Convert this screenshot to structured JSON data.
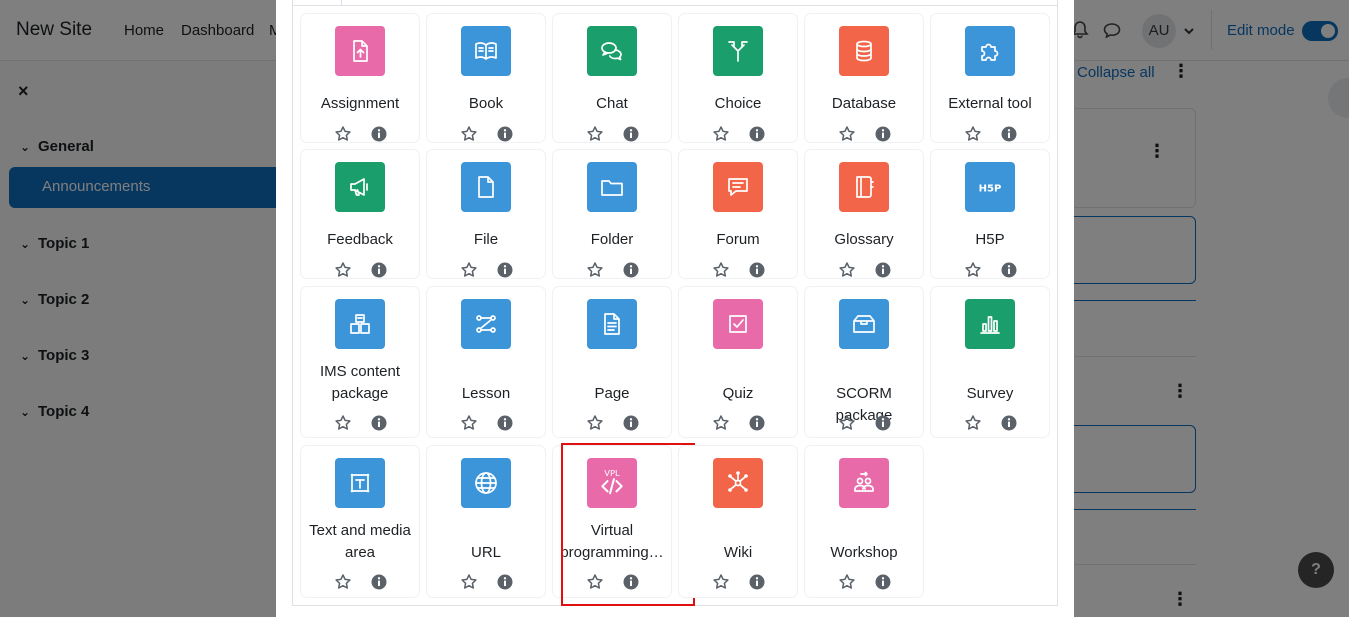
{
  "navbar": {
    "site_name": "New Site",
    "links": [
      "Home",
      "Dashboard",
      "M"
    ],
    "avatar_initials": "AU",
    "edit_mode_label": "Edit mode"
  },
  "drawer": {
    "close_label": "×",
    "sections": [
      {
        "label": "General",
        "expanded": true
      },
      {
        "label": "Topic 1"
      },
      {
        "label": "Topic 2"
      },
      {
        "label": "Topic 3"
      },
      {
        "label": "Topic 4"
      }
    ],
    "active_item": "Announcements"
  },
  "main": {
    "collapse_all": "Collapse all",
    "help_label": "?"
  },
  "colors": {
    "pink": "#e96aa9",
    "blue": "#3d95d9",
    "green": "#1a9e6b",
    "red": "#f26549",
    "brand": "#0f6cbf",
    "highlight": "#e01010"
  },
  "activities": [
    {
      "label": "Assignment",
      "icon": "assignment-icon",
      "color": "pink"
    },
    {
      "label": "Book",
      "icon": "book-icon",
      "color": "blue"
    },
    {
      "label": "Chat",
      "icon": "chat-icon",
      "color": "green"
    },
    {
      "label": "Choice",
      "icon": "choice-icon",
      "color": "green"
    },
    {
      "label": "Database",
      "icon": "database-icon",
      "color": "red"
    },
    {
      "label": "External tool",
      "icon": "puzzle-icon",
      "color": "blue"
    },
    {
      "label": "Feedback",
      "icon": "megaphone-icon",
      "color": "green"
    },
    {
      "label": "File",
      "icon": "file-icon",
      "color": "blue"
    },
    {
      "label": "Folder",
      "icon": "folder-icon",
      "color": "blue"
    },
    {
      "label": "Forum",
      "icon": "forum-icon",
      "color": "red"
    },
    {
      "label": "Glossary",
      "icon": "glossary-icon",
      "color": "red"
    },
    {
      "label": "H5P",
      "icon": "h5p-icon",
      "color": "blue"
    },
    {
      "label": "IMS content package",
      "icon": "ims-package-icon",
      "color": "blue"
    },
    {
      "label": "Lesson",
      "icon": "lesson-icon",
      "color": "blue"
    },
    {
      "label": "Page",
      "icon": "page-icon",
      "color": "blue"
    },
    {
      "label": "Quiz",
      "icon": "quiz-icon",
      "color": "pink"
    },
    {
      "label": "SCORM package",
      "icon": "scorm-icon",
      "color": "blue"
    },
    {
      "label": "Survey",
      "icon": "survey-icon",
      "color": "green"
    },
    {
      "label": "Text and media area",
      "icon": "text-media-icon",
      "color": "blue"
    },
    {
      "label": "URL",
      "icon": "globe-icon",
      "color": "blue"
    },
    {
      "label": "Virtual programming…",
      "icon": "vpl-icon",
      "color": "pink",
      "icon_text": "VPL",
      "highlighted": true
    },
    {
      "label": "Wiki",
      "icon": "wiki-icon",
      "color": "red"
    },
    {
      "label": "Workshop",
      "icon": "workshop-icon",
      "color": "pink"
    }
  ]
}
